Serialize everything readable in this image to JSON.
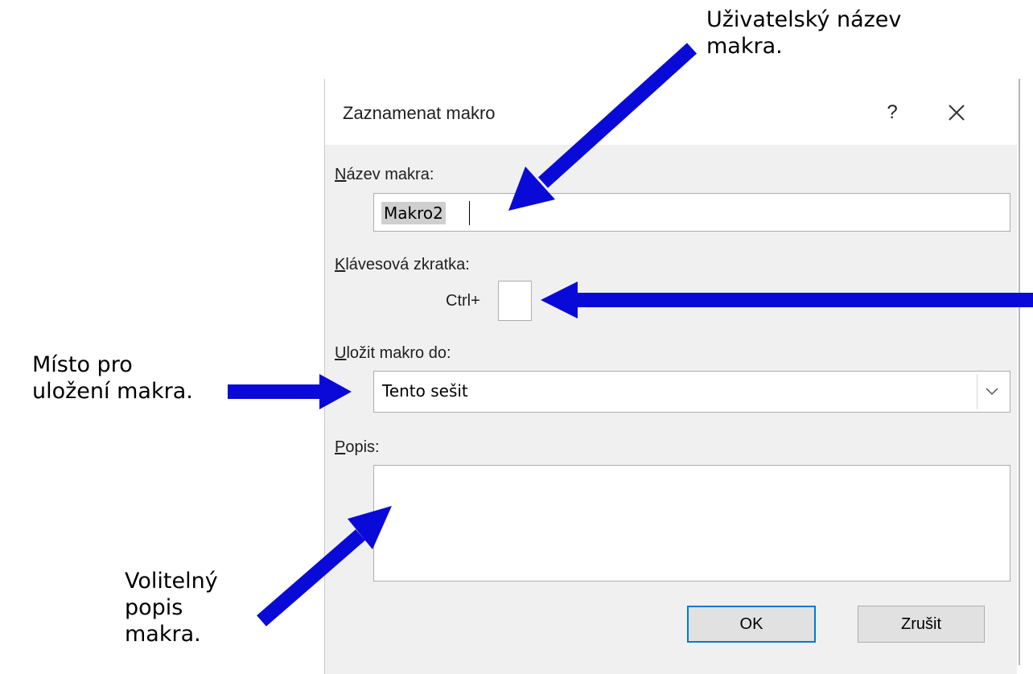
{
  "annotations": {
    "top_line1": "Uživatelský název",
    "top_line2": "makra.",
    "left_line1": "Místo pro",
    "left_line2": "uložení makra.",
    "bottom_line1": "Volitelný",
    "bottom_line2": "popis",
    "bottom_line3": "makra."
  },
  "dialog": {
    "title": "Zaznamenat makro",
    "help": "?",
    "macro_name": {
      "label_key": "N",
      "label_rest": "ázev makra:",
      "value": "Makro2"
    },
    "shortcut": {
      "label_key": "K",
      "label_rest": "lávesová zkratka:",
      "prefix": "Ctrl+",
      "value": ""
    },
    "store_in": {
      "label_key": "U",
      "label_rest": "ložit makro do:",
      "value": "Tento sešit"
    },
    "description": {
      "label_key": "P",
      "label_rest": "opis:",
      "value": ""
    },
    "ok": "OK",
    "cancel": "Zrušit"
  },
  "colors": {
    "arrow": "#0a0ad8",
    "focus": "#0078d7",
    "dialog_bg": "#f0f0f0"
  },
  "icons": {
    "close": "close-icon",
    "dropdown": "chevron-down-icon"
  }
}
